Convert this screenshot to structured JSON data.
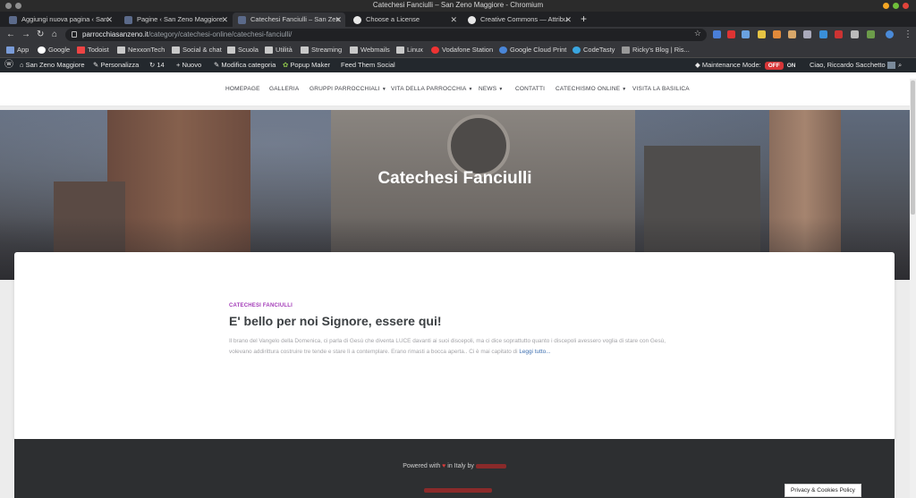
{
  "window": {
    "title": "Catechesi Fanciulli – San Zeno Maggiore - Chromium"
  },
  "tabs": [
    {
      "label": "Aggiungi nuova pagina ‹ San",
      "active": false
    },
    {
      "label": "Pagine ‹ San Zeno Maggiore",
      "active": false
    },
    {
      "label": "Catechesi Fanciulli – San Zen",
      "active": true
    },
    {
      "label": "Choose a License",
      "active": false
    },
    {
      "label": "Creative Commons — Attribu",
      "active": false
    }
  ],
  "address": {
    "host": "parrocchiasanzeno.it",
    "path": "/category/catechesi-online/catechesi-fanciulli/"
  },
  "bookmarks": [
    "App",
    "Google",
    "Todoist",
    "NexxonTech",
    "Social & chat",
    "Scuola",
    "Utilità",
    "Streaming",
    "Webmails",
    "Linux",
    "Vodafone Station",
    "Google Cloud Print",
    "CodeTasty",
    "Ricky's Blog | Ris..."
  ],
  "adminbar": {
    "site": "San Zeno Maggiore",
    "customize": "Personalizza",
    "updates": "14",
    "new": "Nuovo",
    "edit_category": "Modifica categoria",
    "popup_maker": "Popup Maker",
    "feed": "Feed Them Social",
    "maintenance": "Maintenance Mode:",
    "off": "OFF",
    "on": "ON",
    "greeting": "Ciao, Riccardo Sacchetto"
  },
  "nav": [
    {
      "label": "HOMEPAGE",
      "dropdown": false
    },
    {
      "label": "GALLERIA",
      "dropdown": false
    },
    {
      "label": "GRUPPI PARROCCHIALI",
      "dropdown": true
    },
    {
      "label": "VITA DELLA PARROCCHIA",
      "dropdown": true
    },
    {
      "label": "NEWS",
      "dropdown": true
    },
    {
      "label": "CONTATTI",
      "dropdown": false
    },
    {
      "label": "CATECHISMO ONLINE",
      "dropdown": true
    },
    {
      "label": "VISITA LA BASILICA",
      "dropdown": false
    }
  ],
  "hero": {
    "title": "Catechesi Fanciulli"
  },
  "post": {
    "category": "CATECHESI FANCIULLI",
    "title": "E' bello per noi Signore, essere qui!",
    "excerpt": "Il brano del Vangelo della Domenica, ci parla di Gesù che diventa LUCE davanti ai suoi discepoli, ma ci dice soprattutto quanto i discepoli avessero voglia di stare con Gesù, volevano addirittura costruire tre tende e stare lì a contemplare. Erano rimasti a bocca aperta.. Ci è mai capitato di",
    "read_more": "Leggi tutto..."
  },
  "footer": {
    "powered_prefix": "Powered with",
    "powered_suffix": "in Italy by"
  },
  "cookie": "Privacy & Cookies Policy",
  "colors": {
    "accent": "#a33bb8",
    "off_badge": "#d63638",
    "heart": "#d83b3b"
  }
}
